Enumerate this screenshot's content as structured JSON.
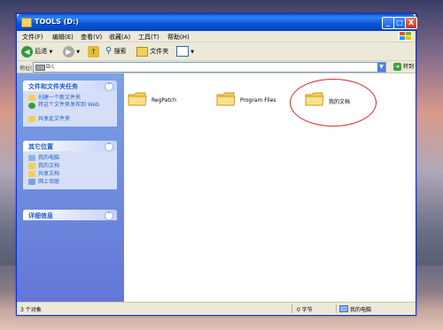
{
  "window": {
    "title": "TOOLS (D:)",
    "controls": {
      "minimize": "_",
      "maximize": "□",
      "close": "X"
    }
  },
  "menubar": {
    "items": [
      "文件(F)",
      "编辑(E)",
      "查看(V)",
      "收藏(A)",
      "工具(T)",
      "帮助(H)"
    ]
  },
  "toolbar": {
    "back": "后退",
    "search": "搜索",
    "folders": "文件夹"
  },
  "address": {
    "label": "地址(D)",
    "value": "D:\\",
    "go": "转到"
  },
  "sidebar": {
    "panels": [
      {
        "title": "文件和文件夹任务",
        "items": [
          "创建一个新文件夹",
          "将这个文件夹发布到 Web",
          "共享此文件夹"
        ]
      },
      {
        "title": "其它位置",
        "items": [
          "我的电脑",
          "我的文档",
          "共享文档",
          "网上邻居"
        ]
      },
      {
        "title": "详细信息",
        "items": []
      }
    ]
  },
  "content": {
    "folders": [
      {
        "name": "RegPatch"
      },
      {
        "name": "Program Files"
      },
      {
        "name": "我的文档"
      }
    ]
  },
  "statusbar": {
    "objects": "3 个对象",
    "size": "0 字节",
    "location": "我的电脑"
  },
  "colors": {
    "titlebar": "#0a58d6",
    "sidebar": "#6375d6",
    "link": "#215dc6",
    "highlight_circle": "#d42a2a",
    "folder": "#f5cf5c"
  }
}
